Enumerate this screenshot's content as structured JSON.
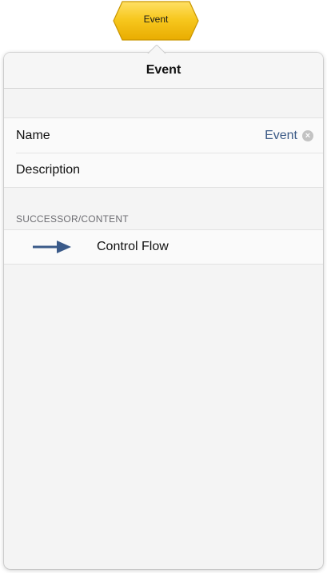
{
  "node": {
    "label": "Event",
    "fill_color": "#f5c000"
  },
  "popover": {
    "title": "Event",
    "fields": {
      "name_label": "Name",
      "name_value": "Event",
      "clear_glyph": "×",
      "description_label": "Description"
    },
    "successor_section": {
      "header": "SUCCESSOR/CONTENT",
      "items": [
        {
          "label": "Control Flow",
          "icon": "right-arrow-icon"
        }
      ]
    }
  },
  "colors": {
    "value_text": "#3b5a86",
    "arrow": "#3a5a89"
  }
}
